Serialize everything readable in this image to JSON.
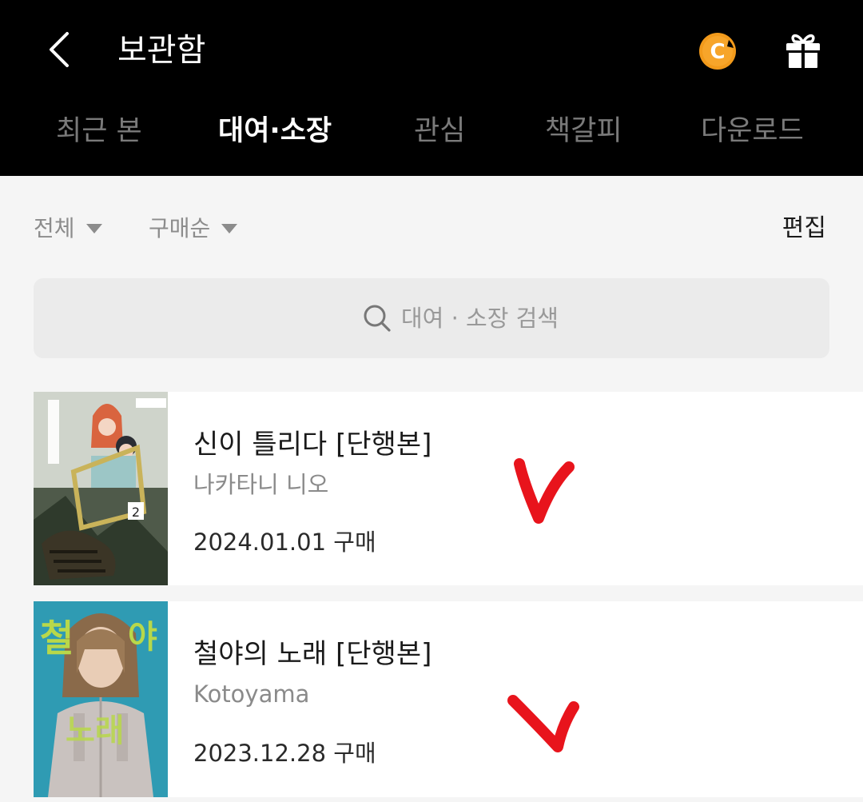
{
  "header": {
    "title": "보관함",
    "coin_letter": "C",
    "accent": "#f29a1b"
  },
  "tabs": [
    {
      "label": "최근 본",
      "active": false
    },
    {
      "label": "대여·소장",
      "active": true
    },
    {
      "label": "관심",
      "active": false
    },
    {
      "label": "책갈피",
      "active": false
    },
    {
      "label": "다운로드",
      "active": false
    }
  ],
  "filters": {
    "all": "전체",
    "sort": "구매순",
    "edit": "편집"
  },
  "search": {
    "placeholder": "대여 · 소장 검색"
  },
  "items": [
    {
      "title": "신이 틀리다 [단행본]",
      "author": "나카타니 니오",
      "date": "2024.01.01 구매"
    },
    {
      "title": "철야의 노래 [단행본]",
      "author": "Kotoyama",
      "date": "2023.12.28 구매"
    }
  ],
  "icons": [
    "back-arrow-icon",
    "coin-icon",
    "gift-icon",
    "search-icon",
    "caret-down-icon",
    "check-mark-icon"
  ],
  "colors": {
    "header_bg": "#000000",
    "active_tab": "#ffffff",
    "inactive_tab": "#7a7a7a",
    "check_mark": "#e8141c"
  }
}
